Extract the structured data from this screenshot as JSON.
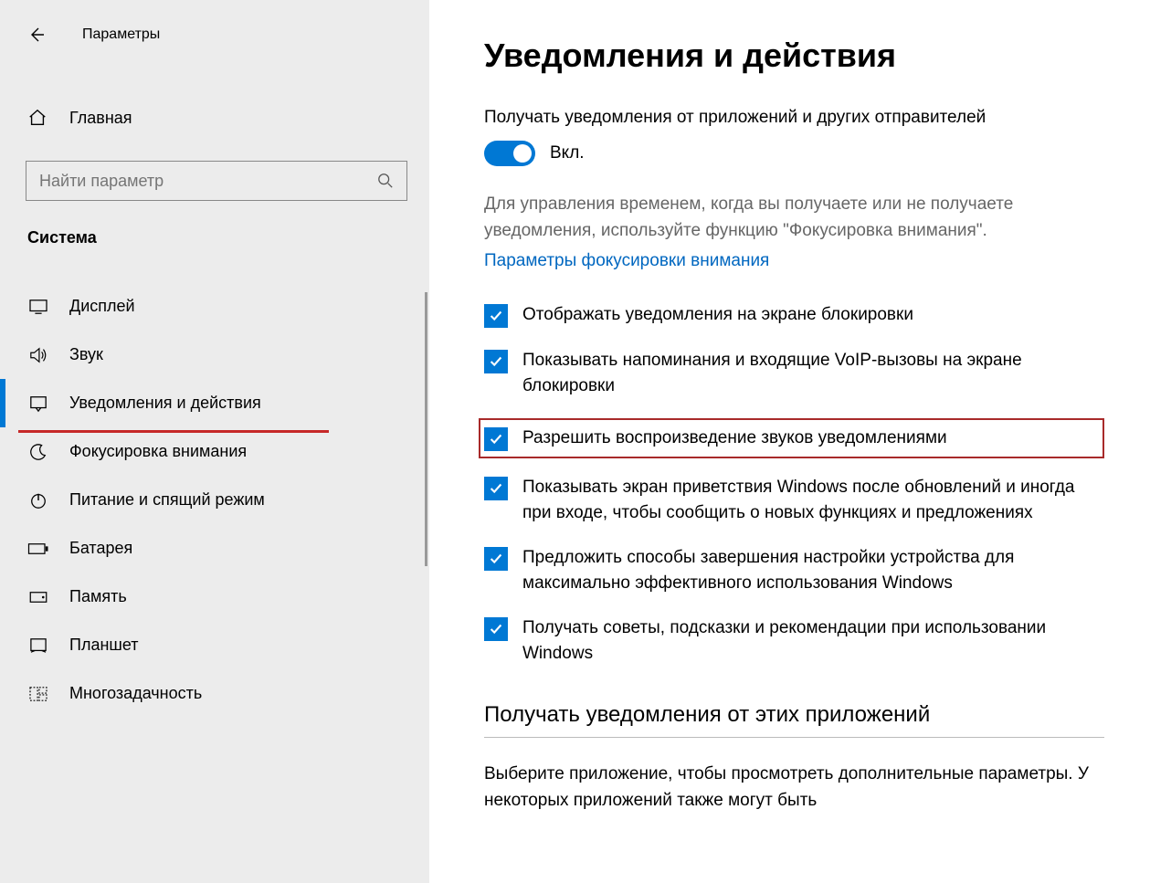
{
  "app_title": "Параметры",
  "home_label": "Главная",
  "search_placeholder": "Найти параметр",
  "sidebar_section": "Система",
  "nav": [
    {
      "label": "Дисплей"
    },
    {
      "label": "Звук"
    },
    {
      "label": "Уведомления и действия"
    },
    {
      "label": "Фокусировка внимания"
    },
    {
      "label": "Питание и спящий режим"
    },
    {
      "label": "Батарея"
    },
    {
      "label": "Память"
    },
    {
      "label": "Планшет"
    },
    {
      "label": "Многозадачность"
    }
  ],
  "page_title": "Уведомления и действия",
  "toggle_title": "Получать уведомления от приложений и других отправителей",
  "toggle_state": "Вкл.",
  "help_text": "Для управления временем, когда вы получаете или не получаете уведомления, используйте функцию \"Фокусировка внимания\".",
  "focus_link": "Параметры фокусировки внимания",
  "checkboxes": [
    {
      "label": "Отображать уведомления на экране блокировки"
    },
    {
      "label": "Показывать напоминания и входящие VoIP-вызовы на экране блокировки"
    },
    {
      "label": "Разрешить  воспроизведение звуков уведомлениями"
    },
    {
      "label": "Показывать экран приветствия Windows после обновлений и иногда при входе, чтобы сообщить о новых функциях и предложениях"
    },
    {
      "label": "Предложить способы завершения настройки устройства для максимально эффективного использования Windows"
    },
    {
      "label": "Получать советы, подсказки и рекомендации при использовании Windows"
    }
  ],
  "subsection_title": "Получать уведомления от этих приложений",
  "subsection_desc": "Выберите приложение, чтобы просмотреть дополнительные параметры. У некоторых приложений также могут быть"
}
